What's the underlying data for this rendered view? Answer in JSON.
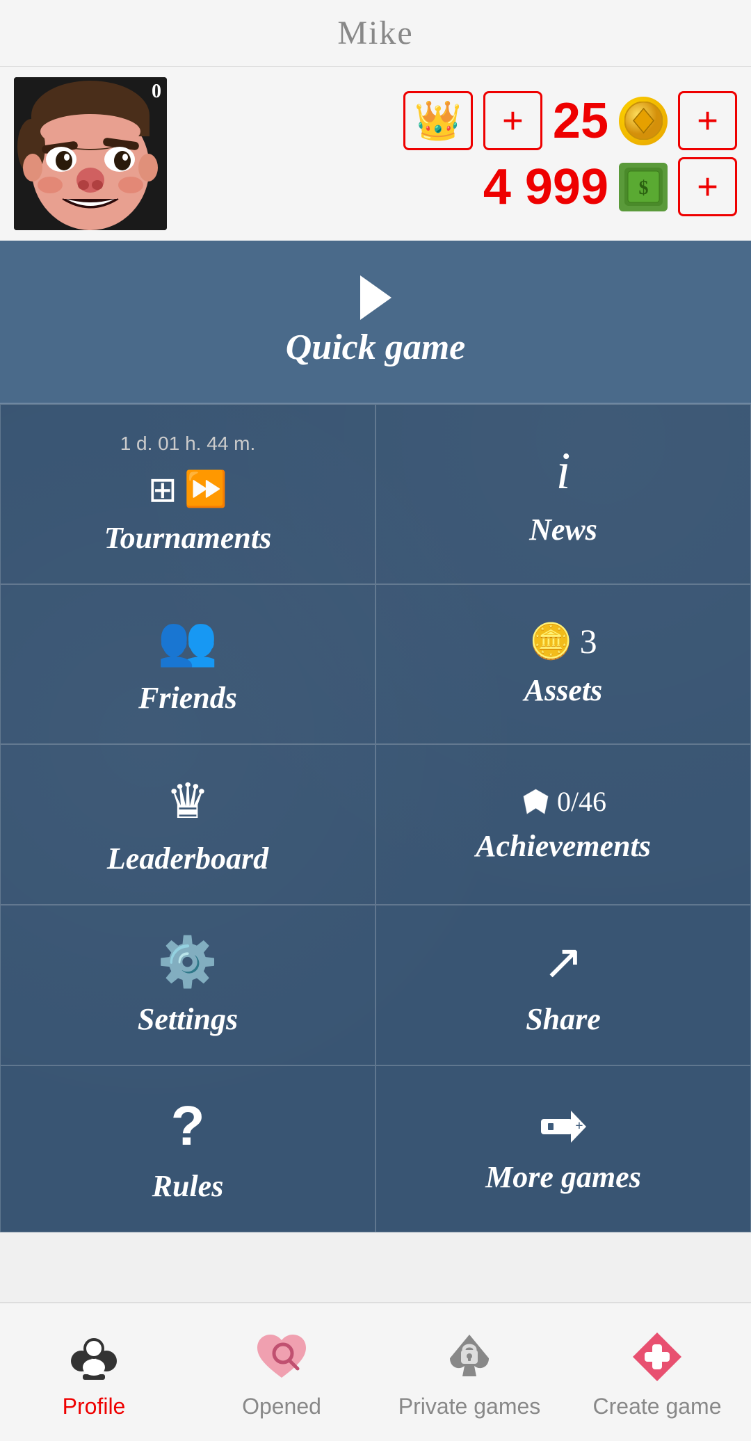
{
  "header": {
    "username": "Mike"
  },
  "profile": {
    "avatar_badge": "0",
    "crown_emoji": "👑",
    "coin_count": "25",
    "money_count": "4 999"
  },
  "menu": {
    "quick_game_label": "Quick game",
    "items": [
      {
        "id": "tournaments",
        "timer": "1 d. 01 h. 44 m.",
        "label": "Tournaments",
        "col": 1
      },
      {
        "id": "news",
        "label": "News",
        "col": 2
      },
      {
        "id": "friends",
        "label": "Friends",
        "col": 1
      },
      {
        "id": "assets",
        "label": "Assets",
        "count": "3",
        "col": 2
      },
      {
        "id": "leaderboard",
        "label": "Leaderboard",
        "col": 1
      },
      {
        "id": "achievements",
        "label": "Achievements",
        "count": "0/46",
        "col": 2
      },
      {
        "id": "settings",
        "label": "Settings",
        "col": 1
      },
      {
        "id": "share",
        "label": "Share",
        "col": 2
      },
      {
        "id": "rules",
        "label": "Rules",
        "col": 1
      },
      {
        "id": "more-games",
        "label": "More games",
        "col": 2
      }
    ]
  },
  "bottom_nav": {
    "items": [
      {
        "id": "profile",
        "label": "Profile",
        "active": true
      },
      {
        "id": "opened",
        "label": "Opened",
        "active": false
      },
      {
        "id": "private-games",
        "label": "Private games",
        "active": false
      },
      {
        "id": "create-game",
        "label": "Create game",
        "active": false
      }
    ]
  }
}
